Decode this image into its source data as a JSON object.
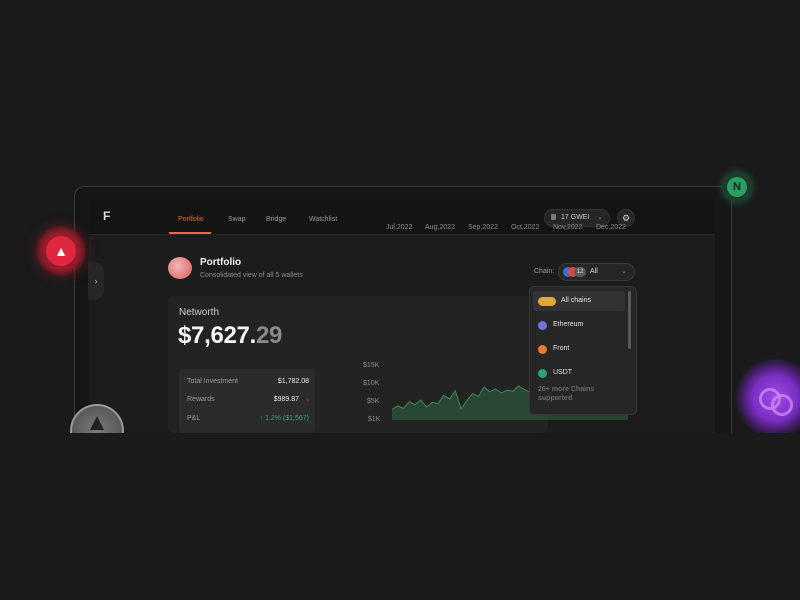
{
  "nav": {
    "tabs": [
      "Portfolio",
      "Swap",
      "Bridge",
      "Watchlist"
    ],
    "active_tab": "Portfolio",
    "gas_label": "17 GWEI"
  },
  "portfolio": {
    "title": "Portfolio",
    "subtitle": "Consolidated view of all 5 wallets",
    "chain_label": "Chain:",
    "chain_count": "12",
    "chain_value": "All"
  },
  "networth": {
    "label": "Networth",
    "value_main": "$7,627.",
    "value_decimal": "29"
  },
  "stats": [
    {
      "label": "Total Investment",
      "value": "$1,782.08"
    },
    {
      "label": "Rewards",
      "value": "$989.87"
    },
    {
      "label": "P&L",
      "value": "↑ 1.2% ($1,567)"
    }
  ],
  "chart_data": {
    "type": "area",
    "y_ticks": [
      "$15K",
      "$10K",
      "$5K",
      "$1K"
    ],
    "x_ticks": [
      "Jul,2022",
      "Aug,2022",
      "Sep,2022",
      "Oct,2022",
      "Nov,2022",
      "Dec,2022"
    ],
    "series": [
      {
        "values": [
          1.8,
          2.4,
          2.0,
          3.1,
          2.6,
          3.4,
          2.2,
          3.0,
          2.8,
          4.2,
          3.6,
          5.0,
          1.9,
          3.3,
          4.5,
          4.0,
          5.6,
          4.8,
          5.3,
          4.6,
          5.1,
          4.9,
          5.8,
          5.2,
          4.7,
          5.5,
          5.0,
          6.2,
          5.4,
          5.9,
          5.3,
          5.7,
          6.0,
          5.6,
          6.3,
          5.8,
          6.1,
          5.9,
          6.4,
          6.0,
          6.6,
          6.2
        ],
        "color": "#3a8a55"
      }
    ],
    "ylim": [
      0,
      15
    ]
  },
  "chain_dropdown": {
    "items": [
      {
        "label": "All chains",
        "icon": "all-chains-icon",
        "color": "#e3a63c",
        "selected": true
      },
      {
        "label": "Ethereum",
        "icon": "ethereum-icon",
        "color": "#6a73d9",
        "selected": false
      },
      {
        "label": "Front",
        "icon": "front-icon",
        "color": "#e87a2a",
        "selected": false
      },
      {
        "label": "USDT",
        "icon": "usdt-icon",
        "color": "#2fa07a",
        "selected": false
      }
    ],
    "more_text": "26+ more Chains supported"
  },
  "colors": {
    "accent": "#ea6a3a",
    "positive": "#3aa86b",
    "negative": "#e24b3c",
    "background": "#1a1a1a"
  }
}
